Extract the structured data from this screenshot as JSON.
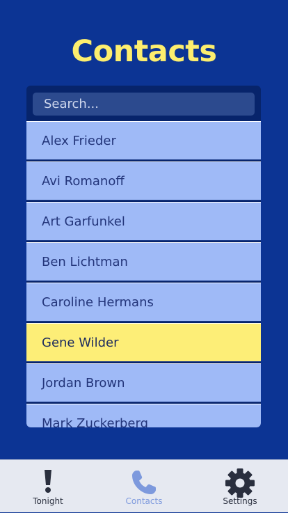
{
  "header": {
    "title": "Contacts"
  },
  "search": {
    "placeholder": "Search..."
  },
  "contacts": [
    {
      "name": "Alex Frieder",
      "selected": false
    },
    {
      "name": "Avi Romanoff",
      "selected": false
    },
    {
      "name": "Art Garfunkel",
      "selected": false
    },
    {
      "name": "Ben Lichtman",
      "selected": false
    },
    {
      "name": "Caroline Hermans",
      "selected": false
    },
    {
      "name": "Gene Wilder",
      "selected": true
    },
    {
      "name": "Jordan Brown",
      "selected": false
    },
    {
      "name": "Mark Zuckerberg",
      "selected": false
    }
  ],
  "tabbar": {
    "tabs": [
      {
        "label": "Tonight",
        "icon": "exclamation-icon",
        "active": false
      },
      {
        "label": "Contacts",
        "icon": "phone-icon",
        "active": true
      },
      {
        "label": "Settings",
        "icon": "gear-icon",
        "active": false
      }
    ]
  },
  "colors": {
    "background": "#0c3494",
    "title": "#fdee6e",
    "row": "#9fbaf7",
    "row_selected": "#fdee77",
    "tab_active": "#7d99dd"
  }
}
